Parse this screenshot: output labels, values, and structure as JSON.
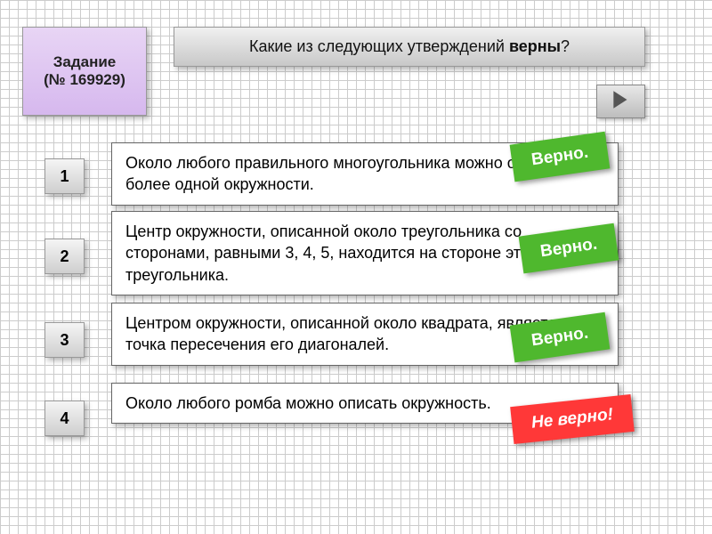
{
  "task": {
    "label": "Задание",
    "number_prefix": "(№ ",
    "number": "169929",
    "number_suffix": ")"
  },
  "question": {
    "prefix": "Какие из следующих утверждений ",
    "emph": "верны",
    "suffix": "?"
  },
  "statements": [
    {
      "num": "1",
      "text": "Около любого правильного многоугольника можно описать не более одной окружности.",
      "badge": "Верно.",
      "correct": true
    },
    {
      "num": "2",
      "text": "Центр окружности, описанной около треугольника со сторонами, равными 3, 4, 5, находится на стороне этого треугольника.",
      "badge": "Верно.",
      "correct": true
    },
    {
      "num": "3",
      "text": "Центром окружности, описанной около квадрата, является точка пересечения его диагоналей.",
      "badge": "Верно.",
      "correct": true
    },
    {
      "num": "4",
      "text": "Около любого ромба можно описать окружность.",
      "badge": "Не верно!",
      "correct": false
    }
  ],
  "nav": {
    "next": "next"
  }
}
